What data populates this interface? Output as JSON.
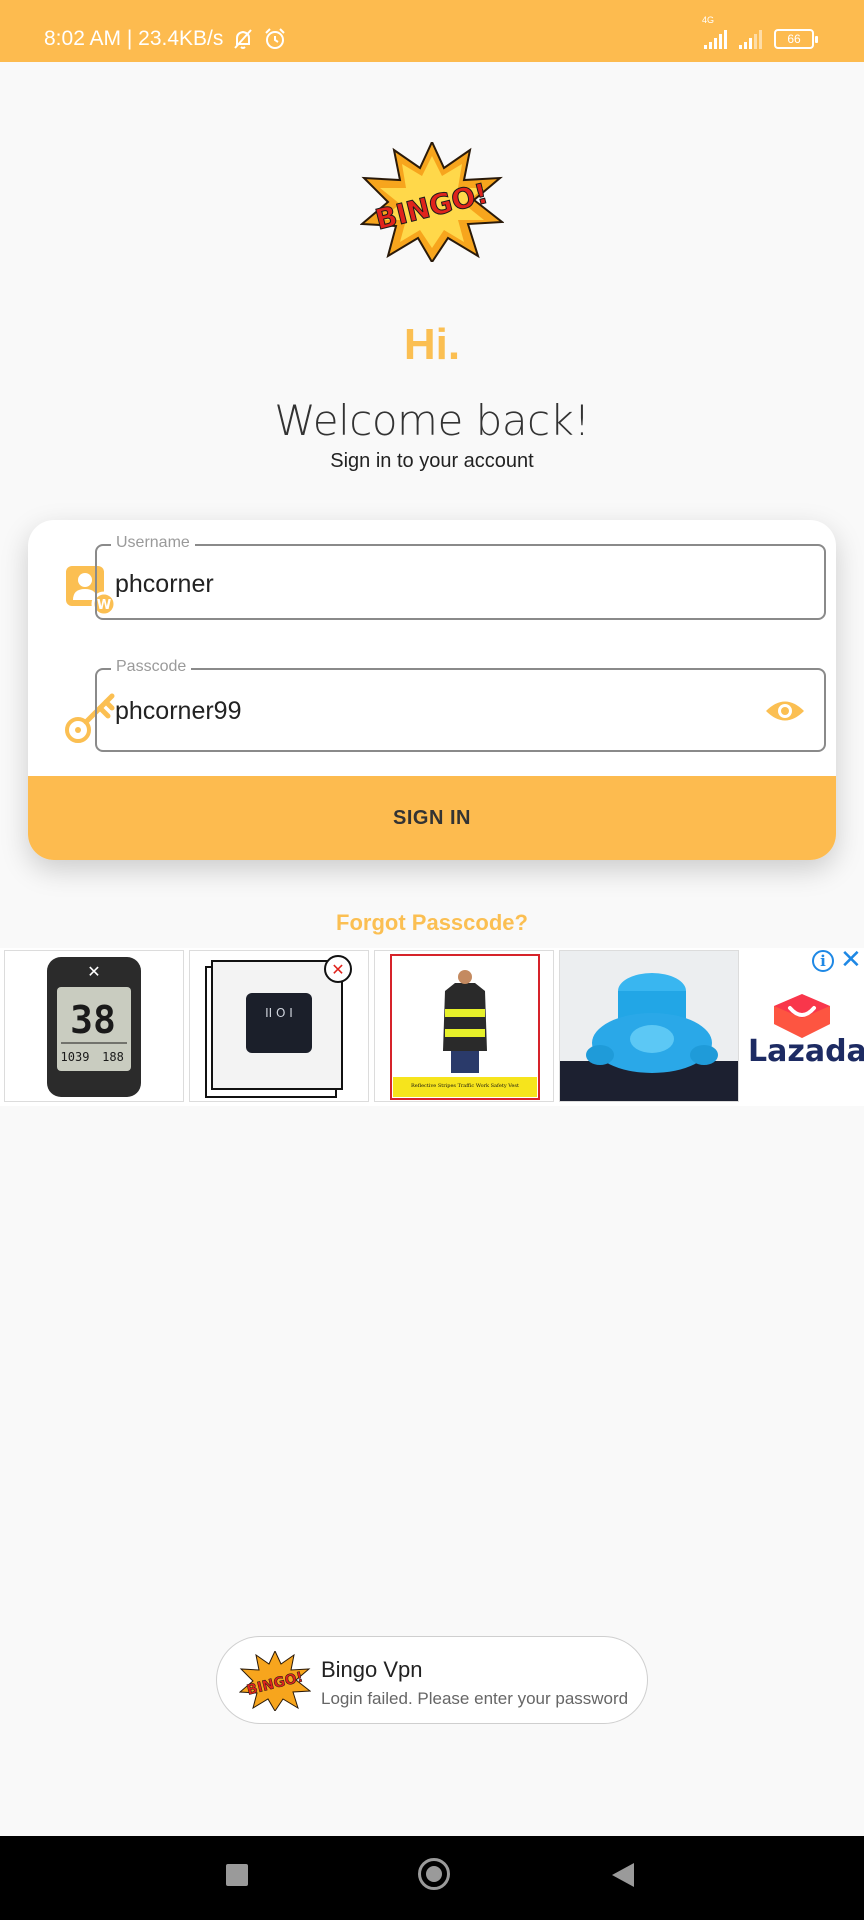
{
  "status": {
    "time_speed": "8:02 AM | 23.4KB/s",
    "network": "4G",
    "battery": "66",
    "icons": [
      "bell-off-icon",
      "alarm-icon",
      "signal-icon",
      "signal-icon",
      "battery-icon"
    ]
  },
  "header": {
    "logo_text": "BINGO!",
    "greeting": "Hi.",
    "welcome": "Welcome back!",
    "subtitle": "Sign in to your account"
  },
  "form": {
    "username": {
      "label": "Username",
      "value": "phcorner",
      "icon": "user-badge-icon"
    },
    "passcode": {
      "label": "Passcode",
      "value": "phcorner99",
      "icon": "key-icon",
      "toggle_icon": "eye-icon"
    },
    "signin_label": "SIGN IN",
    "forgot_label": "Forgot Passcode?"
  },
  "ad": {
    "brand": "Lazada",
    "tiles": [
      {
        "name": "bike-computer",
        "text": "38"
      },
      {
        "name": "rocker-switch",
        "text": "II O I"
      },
      {
        "name": "safety-vest",
        "caption": "Reflective Stripes Traffic Work Safety Vest"
      },
      {
        "name": "plastic-containers"
      }
    ]
  },
  "toast": {
    "title": "Bingo Vpn",
    "message": "Login failed. Please enter your password"
  },
  "colors": {
    "accent": "#fdbb4f",
    "accent_text": "#fbbf52",
    "background": "#f9f9f9"
  }
}
